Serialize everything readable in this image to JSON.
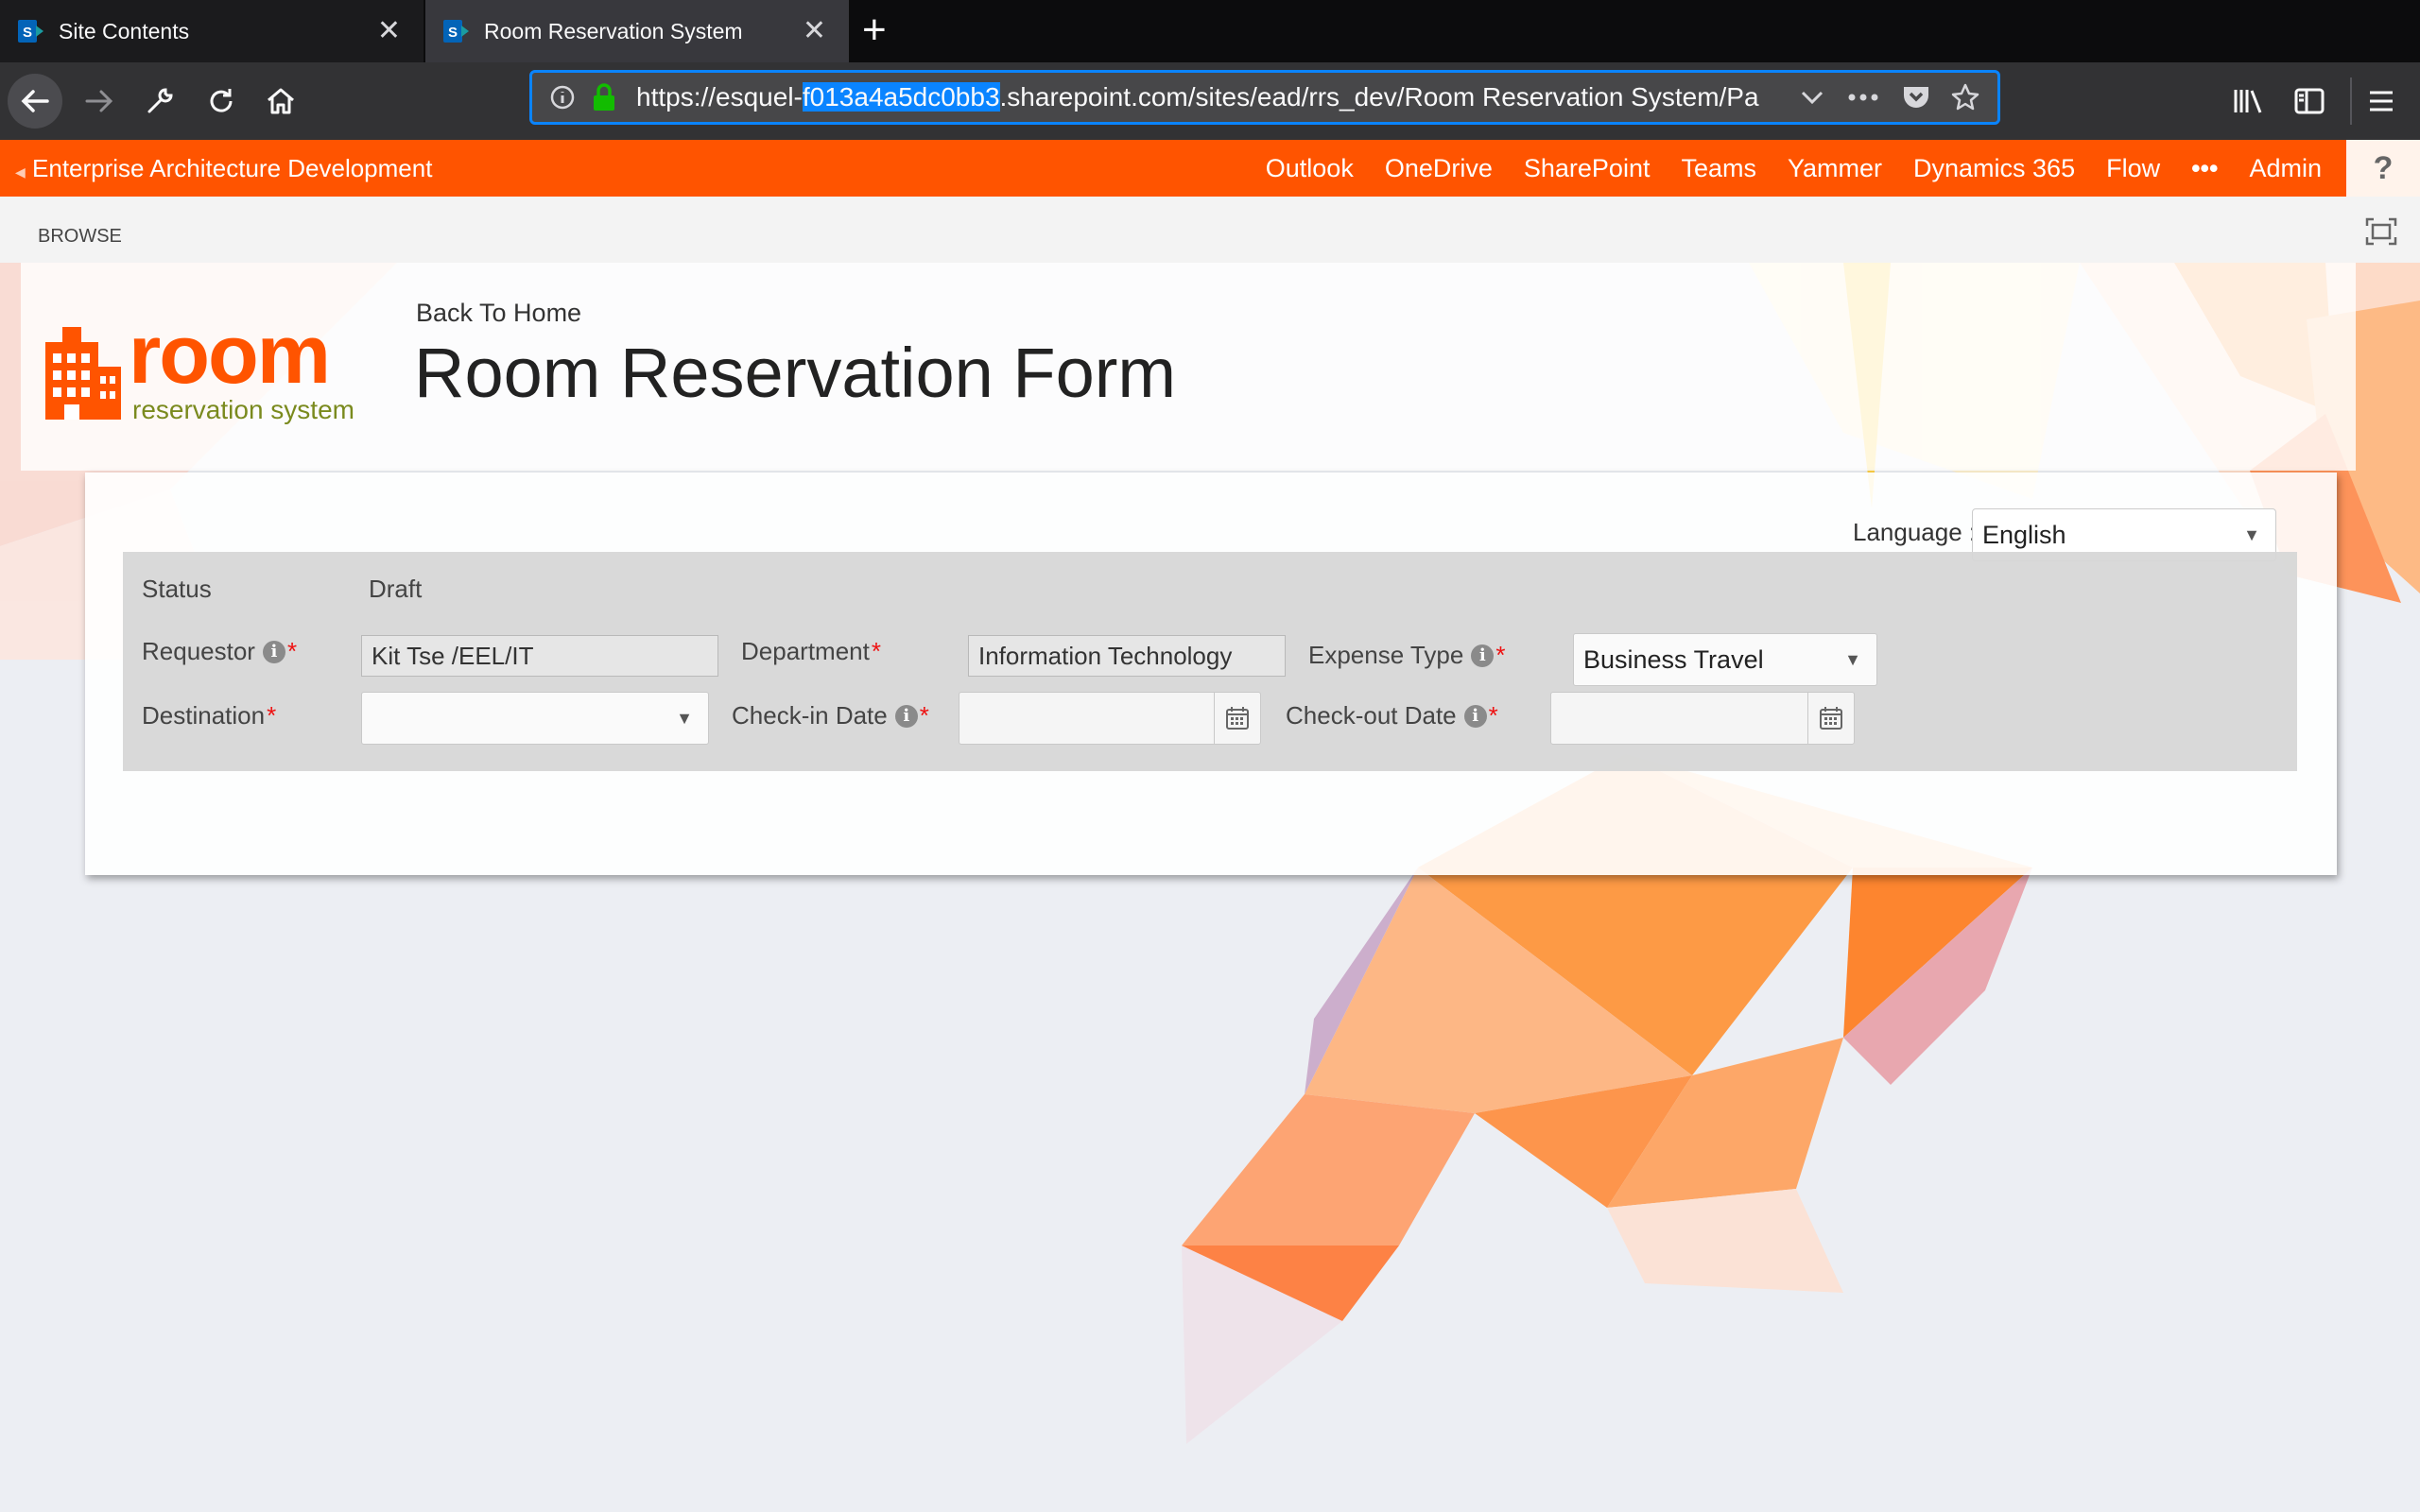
{
  "browser": {
    "tabs": [
      {
        "title": "Site Contents",
        "active": false
      },
      {
        "title": "Room Reservation System",
        "active": true
      }
    ],
    "url": {
      "prefix": "https://esquel-",
      "selected": "f013a4a5dc0bb3",
      "suffix": ".sharepoint.com/sites/ead/rrs_dev/Room Reservation System/Pa"
    }
  },
  "suitebar": {
    "site_name": "Enterprise Architecture Development",
    "links": [
      "Outlook",
      "OneDrive",
      "SharePoint",
      "Teams",
      "Yammer",
      "Dynamics 365",
      "Flow",
      "•••",
      "Admin"
    ],
    "help": "?"
  },
  "ribbon": {
    "browse": "BROWSE"
  },
  "logo": {
    "word": "room",
    "tagline": "reservation system"
  },
  "header": {
    "back_link": "Back To Home",
    "title": "Room Reservation Form"
  },
  "language": {
    "label": "Language :",
    "value": "English"
  },
  "form": {
    "status": {
      "label": "Status",
      "value": "Draft"
    },
    "requestor": {
      "label": "Requestor",
      "value": "Kit Tse /EEL/IT"
    },
    "department": {
      "label": "Department",
      "value": "Information Technology"
    },
    "expense_type": {
      "label": "Expense Type",
      "value": "Business Travel"
    },
    "destination": {
      "label": "Destination",
      "value": ""
    },
    "checkin": {
      "label": "Check-in Date",
      "value": ""
    },
    "checkout": {
      "label": "Check-out Date",
      "value": ""
    },
    "required_mark": "*",
    "info_glyph": "i"
  },
  "colors": {
    "brand": "#ff5400",
    "accent": "#0a84ff",
    "required": "#e11111"
  }
}
